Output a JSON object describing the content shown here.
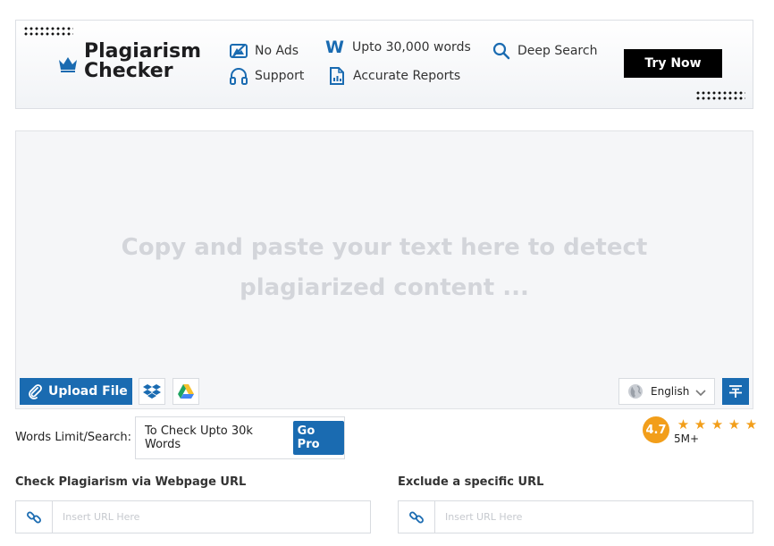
{
  "banner": {
    "brand_line1": "Plagiarism",
    "brand_line2": "Checker",
    "features": {
      "no_ads": "No Ads",
      "support": "Support",
      "words_letter": "W",
      "upto_words": "Upto 30,000 words",
      "accurate_reports": "Accurate Reports",
      "deep_search": "Deep Search"
    },
    "try_now": "Try Now"
  },
  "editor": {
    "placeholder": "Copy and paste your text here to detect plagiarized content ...",
    "upload_label": "Upload File",
    "language": "English",
    "icons": [
      "paperclip-icon",
      "dropbox-icon",
      "google-drive-icon",
      "globe-icon",
      "chevron-down-icon",
      "text-format-icon"
    ]
  },
  "limits": {
    "label": "Words Limit/Search: 0",
    "upsell_text": "To Check Upto 30k Words",
    "go_pro": "Go Pro"
  },
  "rating": {
    "score": "4.7",
    "stars": 5,
    "users": "5M+"
  },
  "url_check": {
    "label": "Check Plagiarism via Webpage URL",
    "placeholder": "Insert URL Here"
  },
  "url_exclude": {
    "label": "Exclude a specific URL",
    "placeholder": "Insert URL Here"
  },
  "colors": {
    "accent": "#1a6bb1",
    "rating": "#f29e1a",
    "placeholder_text": "#d3d5da"
  }
}
